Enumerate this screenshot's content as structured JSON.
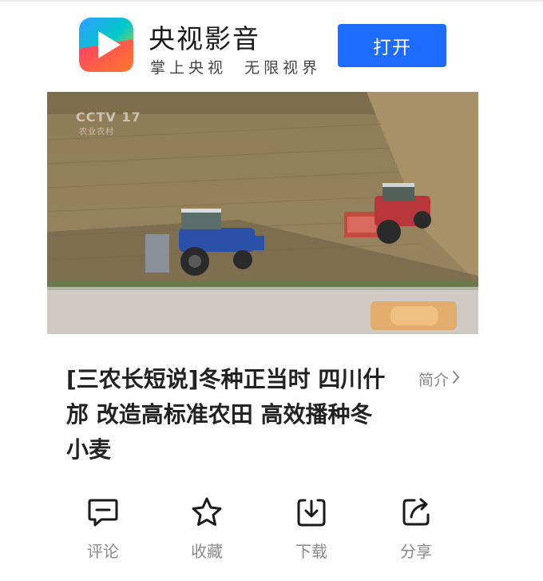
{
  "banner": {
    "app_name": "央视影音",
    "slogan": "掌上央视  无限视界",
    "open_button": "打开"
  },
  "video": {
    "watermark_logo": "CCTV 17",
    "watermark_channel": "农业农村"
  },
  "video_title": "[三农长短说]冬种正当时 四川什邡 改造高标准农田 高效播种冬小麦",
  "intro_link": "简介",
  "actions": [
    {
      "label": "评论",
      "icon": "comment-icon"
    },
    {
      "label": "收藏",
      "icon": "star-icon"
    },
    {
      "label": "下载",
      "icon": "download-icon"
    },
    {
      "label": "分享",
      "icon": "share-icon"
    }
  ],
  "colors": {
    "open_button_bg": "#1e6bff",
    "text_primary": "#222222",
    "text_muted": "#8a8a8a"
  }
}
